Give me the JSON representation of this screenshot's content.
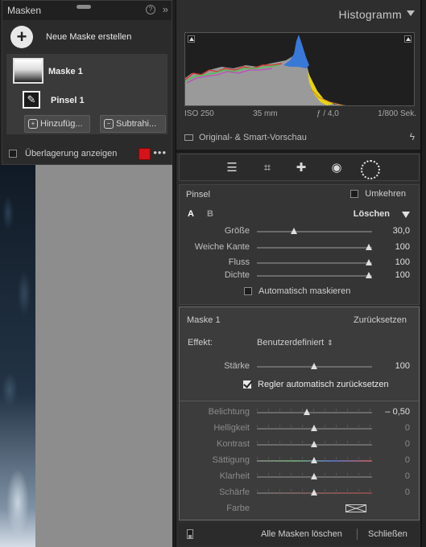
{
  "masks_panel": {
    "title": "Masken",
    "new_mask_label": "Neue Maske erstellen",
    "mask_name": "Maske 1",
    "brush_name": "Pinsel 1",
    "add_label": "Hinzufüg...",
    "subtract_label": "Subtrahi...",
    "overlay_label": "Überlagerung anzeigen",
    "overlay_color": "#d3141a"
  },
  "histogram": {
    "title": "Histogramm",
    "iso": "ISO 250",
    "focal": "35 mm",
    "aperture": "ƒ / 4,0",
    "shutter": "1/800 Sek.",
    "preview_label": "Original- & Smart-Vorschau"
  },
  "tools": [
    "sliders-icon",
    "crop-icon",
    "healing-icon",
    "redeye-icon",
    "mask-icon"
  ],
  "brush": {
    "title": "Pinsel",
    "invert_label": "Umkehren",
    "tab_a": "A",
    "tab_b": "B",
    "delete_label": "Löschen",
    "sliders": [
      {
        "label": "Größe",
        "value": "30,0",
        "pos": 0.32
      },
      {
        "label": "Weiche Kante",
        "value": "100",
        "pos": 1.0
      },
      {
        "label": "Fluss",
        "value": "100",
        "pos": 1.0
      },
      {
        "label": "Dichte",
        "value": "100",
        "pos": 1.0
      }
    ],
    "auto_mask_label": "Automatisch maskieren"
  },
  "mask": {
    "title": "Maske 1",
    "reset_label": "Zurücksetzen",
    "effect_label": "Effekt:",
    "effect_value": "Benutzerdefiniert",
    "amount": {
      "label": "Stärke",
      "value": "100",
      "pos": 0.5
    },
    "auto_reset_label": "Regler automatisch zurücksetzen",
    "adjustments": [
      {
        "label": "Belichtung",
        "value": "– 0,50",
        "pos": 0.45
      },
      {
        "label": "Helligkeit",
        "value": "0",
        "pos": 0.5
      },
      {
        "label": "Kontrast",
        "value": "0",
        "pos": 0.5
      },
      {
        "label": "Sättigung",
        "value": "0",
        "pos": 0.5
      },
      {
        "label": "Klarheit",
        "value": "0",
        "pos": 0.5
      },
      {
        "label": "Schärfe",
        "value": "0",
        "pos": 0.5
      }
    ],
    "color_label": "Farbe"
  },
  "footer": {
    "clear_all_label": "Alle Masken löschen",
    "close_label": "Schließen"
  }
}
